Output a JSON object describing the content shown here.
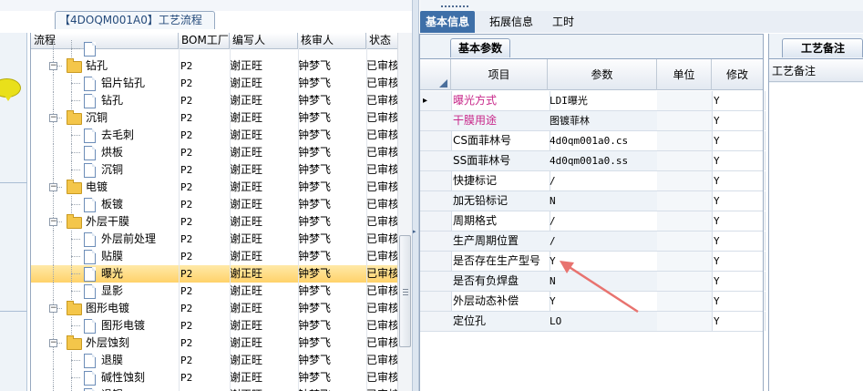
{
  "title_tab": "【4DOQM001A0】工艺流程",
  "tree": {
    "columns": [
      "流程",
      "BOM工厂",
      "编写人",
      "核审人",
      "状态"
    ],
    "rows": [
      {
        "label": "",
        "type": "doc",
        "level": 2,
        "bom": "",
        "writer": "",
        "reviewer": "",
        "status": ""
      },
      {
        "label": "钻孔",
        "type": "folder",
        "level": 1,
        "bom": "P2",
        "writer": "谢正旺",
        "reviewer": "钟梦飞",
        "status": "已审核"
      },
      {
        "label": "铝片钻孔",
        "type": "doc",
        "level": 2,
        "bom": "P2",
        "writer": "谢正旺",
        "reviewer": "钟梦飞",
        "status": "已审核"
      },
      {
        "label": "钻孔",
        "type": "doc",
        "level": 2,
        "bom": "P2",
        "writer": "谢正旺",
        "reviewer": "钟梦飞",
        "status": "已审核"
      },
      {
        "label": "沉铜",
        "type": "folder",
        "level": 1,
        "bom": "P2",
        "writer": "谢正旺",
        "reviewer": "钟梦飞",
        "status": "已审核"
      },
      {
        "label": "去毛刺",
        "type": "doc",
        "level": 2,
        "bom": "P2",
        "writer": "谢正旺",
        "reviewer": "钟梦飞",
        "status": "已审核"
      },
      {
        "label": "烘板",
        "type": "doc",
        "level": 2,
        "bom": "P2",
        "writer": "谢正旺",
        "reviewer": "钟梦飞",
        "status": "已审核"
      },
      {
        "label": "沉铜",
        "type": "doc",
        "level": 2,
        "bom": "P2",
        "writer": "谢正旺",
        "reviewer": "钟梦飞",
        "status": "已审核"
      },
      {
        "label": "电镀",
        "type": "folder",
        "level": 1,
        "bom": "P2",
        "writer": "谢正旺",
        "reviewer": "钟梦飞",
        "status": "已审核"
      },
      {
        "label": "板镀",
        "type": "doc",
        "level": 2,
        "bom": "P2",
        "writer": "谢正旺",
        "reviewer": "钟梦飞",
        "status": "已审核"
      },
      {
        "label": "外层干膜",
        "type": "folder",
        "level": 1,
        "bom": "P2",
        "writer": "谢正旺",
        "reviewer": "钟梦飞",
        "status": "已审核"
      },
      {
        "label": "外层前处理",
        "type": "doc",
        "level": 2,
        "bom": "P2",
        "writer": "谢正旺",
        "reviewer": "钟梦飞",
        "status": "已审核"
      },
      {
        "label": "贴膜",
        "type": "doc",
        "level": 2,
        "bom": "P2",
        "writer": "谢正旺",
        "reviewer": "钟梦飞",
        "status": "已审核"
      },
      {
        "label": "曝光",
        "type": "doc",
        "level": 2,
        "bom": "P2",
        "writer": "谢正旺",
        "reviewer": "钟梦飞",
        "status": "已审核",
        "selected": true
      },
      {
        "label": "显影",
        "type": "doc",
        "level": 2,
        "bom": "P2",
        "writer": "谢正旺",
        "reviewer": "钟梦飞",
        "status": "已审核"
      },
      {
        "label": "图形电镀",
        "type": "folder",
        "level": 1,
        "bom": "P2",
        "writer": "谢正旺",
        "reviewer": "钟梦飞",
        "status": "已审核"
      },
      {
        "label": "图形电镀",
        "type": "doc",
        "level": 2,
        "bom": "P2",
        "writer": "谢正旺",
        "reviewer": "钟梦飞",
        "status": "已审核"
      },
      {
        "label": "外层蚀刻",
        "type": "folder",
        "level": 1,
        "bom": "P2",
        "writer": "谢正旺",
        "reviewer": "钟梦飞",
        "status": "已审核"
      },
      {
        "label": "退膜",
        "type": "doc",
        "level": 2,
        "bom": "P2",
        "writer": "谢正旺",
        "reviewer": "钟梦飞",
        "status": "已审核"
      },
      {
        "label": "碱性蚀刻",
        "type": "doc",
        "level": 2,
        "bom": "P2",
        "writer": "谢正旺",
        "reviewer": "钟梦飞",
        "status": "已审核"
      },
      {
        "label": "退锡",
        "type": "doc",
        "level": 2,
        "bom": "P2",
        "writer": "谢正旺",
        "reviewer": "钟梦飞",
        "status": "已审核"
      }
    ]
  },
  "tabs": [
    "基本信息",
    "拓展信息",
    "工时"
  ],
  "params_tab": "基本参数",
  "grid": {
    "columns": [
      "项目",
      "参数",
      "单位",
      "修改"
    ],
    "rows": [
      {
        "item": "曝光方式",
        "param": "LDI曝光",
        "unit": "",
        "mod": "Y",
        "item_color": "#c8288a",
        "current": true
      },
      {
        "item": "干膜用途",
        "param": "图镀菲林",
        "unit": "",
        "mod": "Y",
        "item_color": "#c8288a"
      },
      {
        "item": "CS面菲林号",
        "param": "4d0qm001a0.cs",
        "unit": "",
        "mod": "Y"
      },
      {
        "item": "SS面菲林号",
        "param": "4d0qm001a0.ss",
        "unit": "",
        "mod": "Y"
      },
      {
        "item": "快捷标记",
        "param": "/",
        "unit": "",
        "mod": "Y"
      },
      {
        "item": "加无铅标记",
        "param": "N",
        "unit": "",
        "mod": "Y"
      },
      {
        "item": "周期格式",
        "param": "/",
        "unit": "",
        "mod": "Y"
      },
      {
        "item": "生产周期位置",
        "param": "/",
        "unit": "",
        "mod": "Y"
      },
      {
        "item": "是否存在生产型号",
        "param": "Y",
        "unit": "",
        "mod": "Y"
      },
      {
        "item": "是否有负焊盘",
        "param": "N",
        "unit": "",
        "mod": "Y"
      },
      {
        "item": "外层动态补偿",
        "param": "Y",
        "unit": "",
        "mod": "Y"
      },
      {
        "item": "定位孔",
        "param": "LO",
        "unit": "",
        "mod": "Y"
      }
    ]
  },
  "remark": {
    "tab": "工艺备注",
    "header": "工艺备注"
  },
  "colors": {
    "tab_active_bg": "#3e6fa8",
    "selected_row": "#ffd26a",
    "highlight_text": "#c8288a",
    "annotation_arrow": "#e8736f"
  },
  "icons": [
    "speech-bubble-icon",
    "folder-icon",
    "document-icon",
    "row-pointer-icon",
    "annotation-arrow"
  ]
}
